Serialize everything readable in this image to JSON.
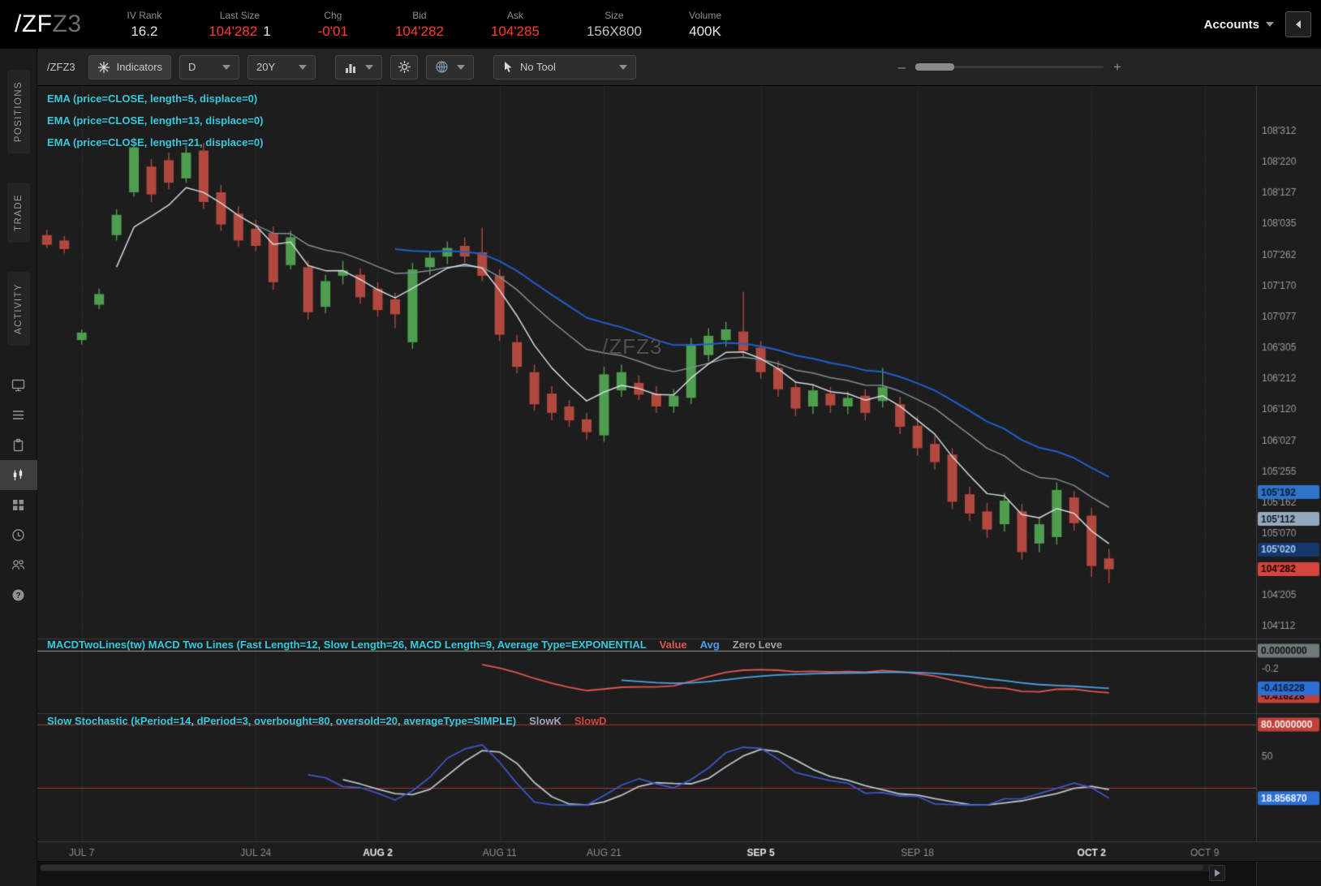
{
  "header": {
    "symbol": "/ZF",
    "symbol_suffix": "Z3",
    "stats": [
      {
        "label": "IV Rank",
        "value": "16.2"
      },
      {
        "label": "Last Size",
        "value": "104'282",
        "value2": "1"
      },
      {
        "label": "Chg",
        "value": "-0'01"
      },
      {
        "label": "Bid",
        "value": "104'282"
      },
      {
        "label": "Ask",
        "value": "104'285"
      },
      {
        "label": "Size",
        "value": "156X800"
      },
      {
        "label": "Volume",
        "value": "400K"
      }
    ],
    "accounts_label": "Accounts"
  },
  "sidebar": {
    "tabs": [
      "POSITIONS",
      "TRADE",
      "ACTIVITY"
    ]
  },
  "toolbar": {
    "symbol": "/ZFZ3",
    "indicators": "Indicators",
    "aggregation": "D",
    "range": "20Y",
    "tool": "No Tool",
    "zoom_minus": "–",
    "zoom_plus": "+"
  },
  "overlays": {
    "ema_labels": [
      "EMA (price=CLOSE, length=5, displace=0)",
      "EMA (price=CLOSE, length=13, displace=0)",
      "EMA (price=CLOSE, length=21, displace=0)"
    ],
    "macd_title": "MACDTwoLines(tw) MACD Two Lines (Fast Length=12, Slow Length=26, MACD Length=9, Average Type=EXPONENTIAL",
    "macd_legend": [
      "Value",
      "Avg",
      "Zero Leve"
    ],
    "stoch_title": "Slow Stochastic (kPeriod=14, dPeriod=3, overbought=80, oversold=20, averageType=SIMPLE)",
    "stoch_legend": [
      "SlowK",
      "SlowD"
    ],
    "watermark": "/ZFZ3"
  },
  "chart_data": {
    "type": "candlestick",
    "symbol": "/ZFZ3",
    "aggregation": "D",
    "price_pane": {
      "domain": [
        104.24,
        109.37
      ],
      "y_axis_labels": [
        {
          "text": "108'312",
          "price": 108.975
        },
        {
          "text": "108'220",
          "price": 108.6875
        },
        {
          "text": "108'127",
          "price": 108.3969
        },
        {
          "text": "108'035",
          "price": 108.1094
        },
        {
          "text": "107'262",
          "price": 107.8188
        },
        {
          "text": "107'170",
          "price": 107.5313
        },
        {
          "text": "107'077",
          "price": 107.2406
        },
        {
          "text": "106'305",
          "price": 106.9531
        },
        {
          "text": "106'212",
          "price": 106.6625
        },
        {
          "text": "106'120",
          "price": 106.375
        },
        {
          "text": "106'027",
          "price": 106.0844
        },
        {
          "text": "105'255",
          "price": 105.7969
        },
        {
          "text": "105'162",
          "price": 105.5063
        },
        {
          "text": "105'070",
          "price": 105.2188
        },
        {
          "text": "104'205",
          "price": 104.6406
        },
        {
          "text": "104'112",
          "price": 104.352
        }
      ],
      "price_badges": [
        {
          "text": "105'192",
          "price": 105.6,
          "bg": "#2f73c9",
          "fg": "#0a1c33"
        },
        {
          "text": "105'112",
          "price": 105.35,
          "bg": "#93a9bd",
          "fg": "#14191f"
        },
        {
          "text": "105'020",
          "price": 105.0625,
          "bg": "#14386b",
          "fg": "#9fc6f2"
        },
        {
          "text": "104'282",
          "price": 104.88125,
          "bg": "#d6453c",
          "fg": "#160404"
        }
      ]
    },
    "x_axis": [
      {
        "text": "JUL 7",
        "i": 2,
        "strong": false
      },
      {
        "text": "JUL 24",
        "i": 12,
        "strong": false
      },
      {
        "text": "AUG 2",
        "i": 19,
        "strong": true
      },
      {
        "text": "AUG 11",
        "i": 26,
        "strong": false
      },
      {
        "text": "AUG 21",
        "i": 32,
        "strong": false
      },
      {
        "text": "SEP 5",
        "i": 41,
        "strong": true
      },
      {
        "text": "SEP 18",
        "i": 50,
        "strong": false
      },
      {
        "text": "OCT 2",
        "i": 60,
        "strong": true
      },
      {
        "text": "OCT 9",
        "i": 66.5,
        "strong": false
      }
    ],
    "candles": [
      [
        108.0,
        108.05,
        107.88,
        107.91
      ],
      [
        107.95,
        107.99,
        107.83,
        107.87
      ],
      [
        107.02,
        107.12,
        106.98,
        107.09
      ],
      [
        107.35,
        107.5,
        107.31,
        107.45
      ],
      [
        108.0,
        108.24,
        107.95,
        108.19
      ],
      [
        108.4,
        108.91,
        108.36,
        108.82
      ],
      [
        108.64,
        108.71,
        108.31,
        108.38
      ],
      [
        108.7,
        108.77,
        108.43,
        108.49
      ],
      [
        108.53,
        108.84,
        108.49,
        108.77
      ],
      [
        108.79,
        108.86,
        108.24,
        108.31
      ],
      [
        108.4,
        108.47,
        108.04,
        108.1
      ],
      [
        108.2,
        108.27,
        107.89,
        107.95
      ],
      [
        108.06,
        108.14,
        107.85,
        107.9
      ],
      [
        108.02,
        108.08,
        107.49,
        107.56
      ],
      [
        107.72,
        108.04,
        107.68,
        107.98
      ],
      [
        107.7,
        107.76,
        107.21,
        107.28
      ],
      [
        107.33,
        107.63,
        107.27,
        107.57
      ],
      [
        107.62,
        107.76,
        107.54,
        107.67
      ],
      [
        107.63,
        107.69,
        107.36,
        107.42
      ],
      [
        107.5,
        107.56,
        107.24,
        107.3
      ],
      [
        107.4,
        107.46,
        107.13,
        107.26
      ],
      [
        107.0,
        107.74,
        106.94,
        107.68
      ],
      [
        107.7,
        107.85,
        107.63,
        107.79
      ],
      [
        107.8,
        107.94,
        107.73,
        107.88
      ],
      [
        107.9,
        107.98,
        107.74,
        107.8
      ],
      [
        107.84,
        108.07,
        107.57,
        107.62
      ],
      [
        107.62,
        107.68,
        107.01,
        107.07
      ],
      [
        107.0,
        107.07,
        106.71,
        106.77
      ],
      [
        106.72,
        106.79,
        106.36,
        106.42
      ],
      [
        106.52,
        106.59,
        106.27,
        106.34
      ],
      [
        106.4,
        106.46,
        106.21,
        106.27
      ],
      [
        106.28,
        106.34,
        106.09,
        106.16
      ],
      [
        106.13,
        106.77,
        106.07,
        106.7
      ],
      [
        106.55,
        106.79,
        106.49,
        106.72
      ],
      [
        106.62,
        106.69,
        106.46,
        106.51
      ],
      [
        106.52,
        106.59,
        106.34,
        106.4
      ],
      [
        106.4,
        106.56,
        106.34,
        106.5
      ],
      [
        106.48,
        107.04,
        106.42,
        106.98
      ],
      [
        106.88,
        107.13,
        106.82,
        107.06
      ],
      [
        107.02,
        107.19,
        106.96,
        107.12
      ],
      [
        107.1,
        107.47,
        106.86,
        106.92
      ],
      [
        106.95,
        107.01,
        106.66,
        106.72
      ],
      [
        106.76,
        106.83,
        106.49,
        106.56
      ],
      [
        106.58,
        106.64,
        106.31,
        106.38
      ],
      [
        106.4,
        106.61,
        106.33,
        106.55
      ],
      [
        106.52,
        106.58,
        106.34,
        106.41
      ],
      [
        106.4,
        106.54,
        106.33,
        106.48
      ],
      [
        106.5,
        106.56,
        106.27,
        106.34
      ],
      [
        106.45,
        106.76,
        106.39,
        106.58
      ],
      [
        106.42,
        106.49,
        106.14,
        106.21
      ],
      [
        106.22,
        106.31,
        105.94,
        106.01
      ],
      [
        106.05,
        106.13,
        105.81,
        105.88
      ],
      [
        105.95,
        106.01,
        105.44,
        105.51
      ],
      [
        105.58,
        105.65,
        105.33,
        105.4
      ],
      [
        105.42,
        105.5,
        105.17,
        105.25
      ],
      [
        105.3,
        105.59,
        105.23,
        105.52
      ],
      [
        105.42,
        105.49,
        104.97,
        105.04
      ],
      [
        105.12,
        105.37,
        105.04,
        105.3
      ],
      [
        105.18,
        105.69,
        105.11,
        105.62
      ],
      [
        105.55,
        105.61,
        105.24,
        105.31
      ],
      [
        105.38,
        105.45,
        104.81,
        104.91
      ],
      [
        104.98,
        105.07,
        104.75,
        104.88
      ]
    ],
    "overlays": {
      "ema_periods": [
        5,
        13,
        21
      ],
      "ema_colors": {
        "5": "#d3dbe0",
        "13": "#7e8f9a",
        "21": "#1f5fce"
      }
    },
    "macd": {
      "fast": 12,
      "slow": 26,
      "length": 9,
      "zero_badge": "0.0000000",
      "tick": "-0.2",
      "value_badge": "-0.416228",
      "value_color": "#e0564e",
      "avg_color": "#4f9fe8"
    },
    "stoch": {
      "kPeriod": 14,
      "dPeriod": 3,
      "overbought": 80,
      "oversold": 20,
      "ob_badge": "80.0000000",
      "mid_label": "50",
      "k_badge": "18.856870",
      "k_color": "#3b57c8",
      "d_color": "#b7c2cb"
    },
    "colors": {
      "up": "#4f9e4f",
      "down": "#b2493f",
      "grid": "#272727",
      "divider": "#3b3b3b",
      "axis_text": "#9c9c9c",
      "zero_line": "#9b9b9b",
      "ob_os_line": "#a33a33"
    }
  }
}
